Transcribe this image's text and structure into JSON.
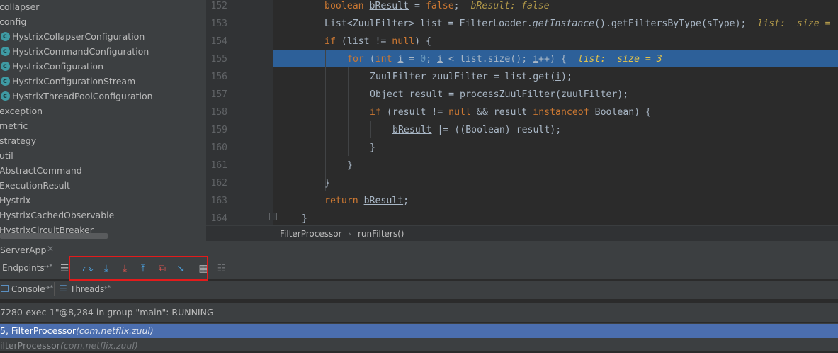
{
  "project_tree": {
    "items": [
      {
        "label": "collapser",
        "type": "folder"
      },
      {
        "label": "config",
        "type": "folder"
      },
      {
        "label": "HystrixCollapserConfiguration",
        "type": "class"
      },
      {
        "label": "HystrixCommandConfiguration",
        "type": "class"
      },
      {
        "label": "HystrixConfiguration",
        "type": "class"
      },
      {
        "label": "HystrixConfigurationStream",
        "type": "class"
      },
      {
        "label": "HystrixThreadPoolConfiguration",
        "type": "class"
      },
      {
        "label": "exception",
        "type": "folder"
      },
      {
        "label": "metric",
        "type": "folder"
      },
      {
        "label": "strategy",
        "type": "folder"
      },
      {
        "label": "util",
        "type": "folder"
      },
      {
        "label": "AbstractCommand",
        "type": "class"
      },
      {
        "label": "ExecutionResult",
        "type": "class"
      },
      {
        "label": "Hystrix",
        "type": "class"
      },
      {
        "label": "HystrixCachedObservable",
        "type": "class"
      },
      {
        "label": "HystrixCircuitBreaker",
        "type": "class"
      }
    ]
  },
  "editor": {
    "line_numbers": [
      "152",
      "153",
      "154",
      "155",
      "156",
      "157",
      "158",
      "159",
      "160",
      "161",
      "162",
      "163",
      "164"
    ],
    "highlighted_line": "155",
    "hints": {
      "l152": "bResult: false",
      "l153": "list:  size = ",
      "l155": "list:  size = 3"
    }
  },
  "breadcrumb": {
    "class_name": "FilterProcessor",
    "method_name": "runFilters()"
  },
  "debug": {
    "session_tab": "ServerApp",
    "endpoints_label": "Endpoints",
    "console_tab": "Console",
    "threads_tab": "Threads",
    "thread_status": "7280-exec-1\"@8,284 in group \"main\": RUNNING",
    "frames": [
      {
        "method": "5, FilterProcessor",
        "pkg": "(com.netflix.zuul)"
      },
      {
        "method": "ilterProcessor",
        "pkg": "(com.netflix.zuul)"
      }
    ]
  },
  "toolbar_icons": [
    "list-icon",
    "step-over-icon",
    "step-into-icon",
    "force-step-into-icon",
    "step-out-icon",
    "drop-frame-icon",
    "run-to-cursor-icon",
    "evaluate-icon",
    "trace-icon"
  ],
  "colors": {
    "accent_selection": "#2d6099",
    "frame_selection": "#4b6eaf",
    "highlight_box": "#e31b1b"
  }
}
